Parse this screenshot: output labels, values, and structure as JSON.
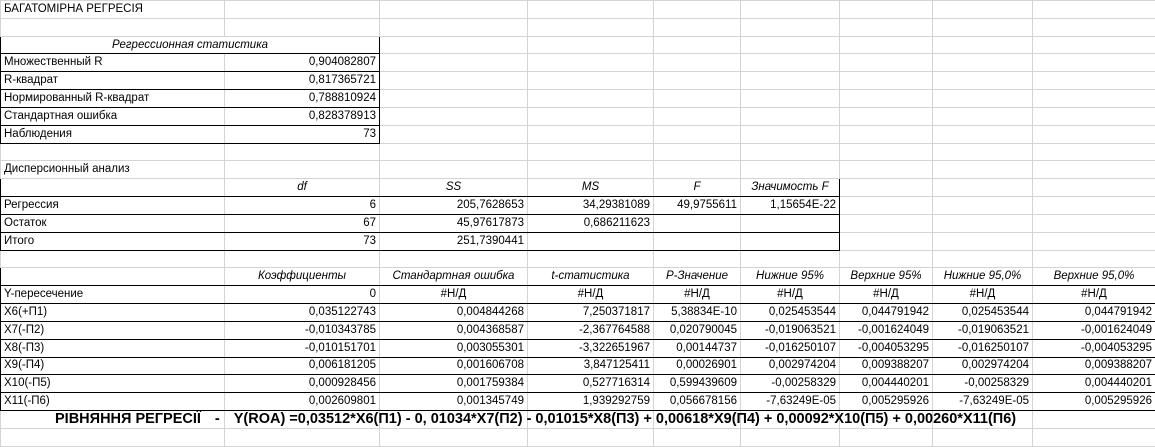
{
  "sheet_title": "БАГАТОМІРНА РЕГРЕСІЯ",
  "regression_statistics": {
    "header": "Регрессионная статистика",
    "rows": [
      {
        "label": "Множественный R",
        "value": "0,904082807"
      },
      {
        "label": "R-квадрат",
        "value": "0,817365721"
      },
      {
        "label": "Нормированный R-квадрат",
        "value": "0,788810924"
      },
      {
        "label": "Стандартная ошибка",
        "value": "0,828378913"
      },
      {
        "label": "Наблюдения",
        "value": "73"
      }
    ]
  },
  "anova": {
    "title": "Дисперсионный анализ",
    "headers": [
      "df",
      "SS",
      "MS",
      "F",
      "Значимость F"
    ],
    "rows": [
      {
        "label": "Регрессия",
        "cells": [
          "6",
          "205,7628653",
          "34,29381089",
          "49,9755611",
          "1,15654E-22"
        ]
      },
      {
        "label": "Остаток",
        "cells": [
          "67",
          "45,97617873",
          "0,686211623",
          "",
          ""
        ]
      },
      {
        "label": "Итого",
        "cells": [
          "73",
          "251,7390441",
          "",
          "",
          ""
        ]
      }
    ]
  },
  "coefficients": {
    "headers": [
      "Коэффициенты",
      "Стандартная ошибка",
      "t-статистика",
      "P-Значение",
      "Нижние 95%",
      "Верхние 95%",
      "Нижние 95,0%",
      "Верхние 95,0%"
    ],
    "rows": [
      {
        "label": "Y-пересечение",
        "cells": [
          "0",
          "#Н/Д",
          "#Н/Д",
          "#Н/Д",
          "#Н/Д",
          "#Н/Д",
          "#Н/Д",
          "#Н/Д"
        ]
      },
      {
        "label": "X6(+П1)",
        "cells": [
          "0,035122743",
          "0,004844268",
          "7,250371817",
          "5,38834E-10",
          "0,025453544",
          "0,044791942",
          "0,025453544",
          "0,044791942"
        ]
      },
      {
        "label": "X7(-П2)",
        "cells": [
          "-0,010343785",
          "0,004368587",
          "-2,367764588",
          "0,020790045",
          "-0,019063521",
          "-0,001624049",
          "-0,019063521",
          "-0,001624049"
        ]
      },
      {
        "label": "X8(-П3)",
        "cells": [
          "-0,010151701",
          "0,003055301",
          "-3,322651967",
          "0,00144737",
          "-0,016250107",
          "-0,004053295",
          "-0,016250107",
          "-0,004053295"
        ]
      },
      {
        "label": "X9(-П4)",
        "cells": [
          "0,006181205",
          "0,001606708",
          "3,847125411",
          "0,00026901",
          "0,002974204",
          "0,009388207",
          "0,002974204",
          "0,009388207"
        ]
      },
      {
        "label": "X10(-П5)",
        "cells": [
          "0,000928456",
          "0,001759384",
          "0,527716314",
          "0,599439609",
          "-0,00258329",
          "0,004440201",
          "-0,00258329",
          "0,004440201"
        ]
      },
      {
        "label": "X11(-П6)",
        "cells": [
          "0,002609801",
          "0,001345749",
          "1,939292759",
          "0,056678156",
          "-7,63249E-05",
          "0,005295926",
          "-7,63249E-05",
          "0,005295926"
        ]
      }
    ]
  },
  "equation": {
    "label": "РІВНЯННЯ РЕГРЕСІЇ",
    "dash": "-",
    "formula": "Y(ROA) =0,03512*X6(П1) - 0, 01034*X7(П2) - 0,01015*X8(П3) + 0,00618*X9(П4) + 0,00092*X10(П5) + 0,00260*X11(П6)"
  }
}
